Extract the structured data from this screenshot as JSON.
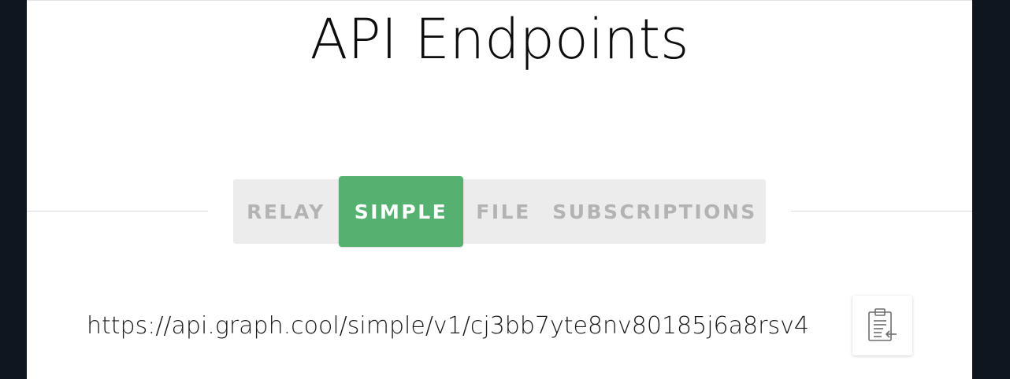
{
  "modal": {
    "title": "API Endpoints"
  },
  "tabs": [
    {
      "label": "RELAY",
      "selected": false
    },
    {
      "label": "SIMPLE",
      "selected": true
    },
    {
      "label": "FILE",
      "selected": false
    },
    {
      "label": "SUBSCRIPTIONS",
      "selected": false
    }
  ],
  "endpoint": {
    "url": "https://api.graph.cool/simple/v1/cj3bb7yte8nv80185j6a8rsv4"
  },
  "copy_button": {
    "icon": "clipboard-copy-icon"
  },
  "colors": {
    "accent": "#54b170",
    "tab_bar": "#ececec",
    "tab_text": "#b3b3b3",
    "backdrop": "#0e1720"
  }
}
